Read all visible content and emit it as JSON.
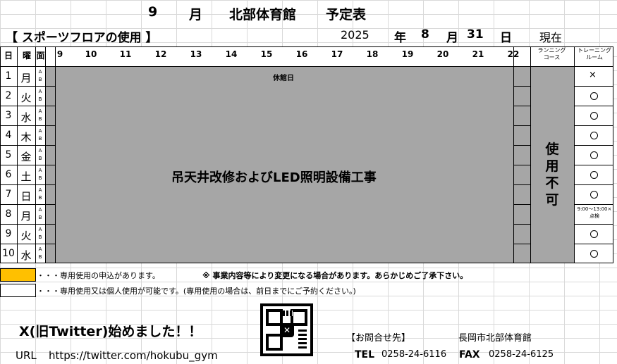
{
  "header": {
    "month": "9",
    "month_unit": "月",
    "facility": "北部体育館",
    "schedule": "予定表",
    "area": "【 スポーツフロアの使用 】",
    "year": "2025",
    "year_unit": "年",
    "date_month": "8",
    "date_month_unit": "月",
    "date_day": "31",
    "date_day_unit": "日",
    "as_of": "現在"
  },
  "columns": {
    "day": "日",
    "weekday": "曜",
    "face": "面",
    "hours": [
      "9",
      "10",
      "11",
      "12",
      "13",
      "14",
      "15",
      "16",
      "17",
      "18",
      "19",
      "20",
      "21",
      "22"
    ],
    "running_1": "ランニング",
    "running_2": "コース",
    "training_1": "トレーニング",
    "training_2": "ルーム"
  },
  "rows": [
    {
      "day": "1",
      "weekday": "月",
      "training": "×"
    },
    {
      "day": "2",
      "weekday": "火",
      "training": "○"
    },
    {
      "day": "3",
      "weekday": "水",
      "training": "○"
    },
    {
      "day": "4",
      "weekday": "木",
      "training": "○"
    },
    {
      "day": "5",
      "weekday": "金",
      "training": "○"
    },
    {
      "day": "6",
      "weekday": "土",
      "training": "○"
    },
    {
      "day": "7",
      "weekday": "日",
      "training": "○"
    },
    {
      "day": "8",
      "weekday": "月",
      "training": "9:00～13:00×\n点検"
    },
    {
      "day": "9",
      "weekday": "火",
      "training": "○"
    },
    {
      "day": "10",
      "weekday": "水",
      "training": "○"
    }
  ],
  "ab_labels": {
    "a": "A",
    "b": "B"
  },
  "closed_day": "休館日",
  "construction": "吊天井改修およびLED照明設備工事",
  "running_status": [
    "使",
    "用",
    "不",
    "可"
  ],
  "training_row8_line1": "9:00～13:00×",
  "training_row8_line2": "点検",
  "legend": {
    "exclusive": "・・・専用使用の申込があります。",
    "notice": "※ 事業内容等により変更になる場合があります。あらかじめご了承下さい。",
    "open": "・・・専用使用又は個人使用が可能です。(専用使用の場合は、前日までにご予約ください。)"
  },
  "footer": {
    "twitter": "X(旧Twitter)始めました！！",
    "url_label": "URL",
    "url": "https://twitter.com/hokubu_gym",
    "contact_label": "【お問合せ先】",
    "contact_name": "長岡市北部体育館",
    "tel_label": "TEL",
    "tel": "0258-24-6116",
    "fax_label": "FAX",
    "fax": "0258-24-6125"
  },
  "colors": {
    "gray": "#a6a6a6",
    "exclusive": "#ffc000"
  }
}
